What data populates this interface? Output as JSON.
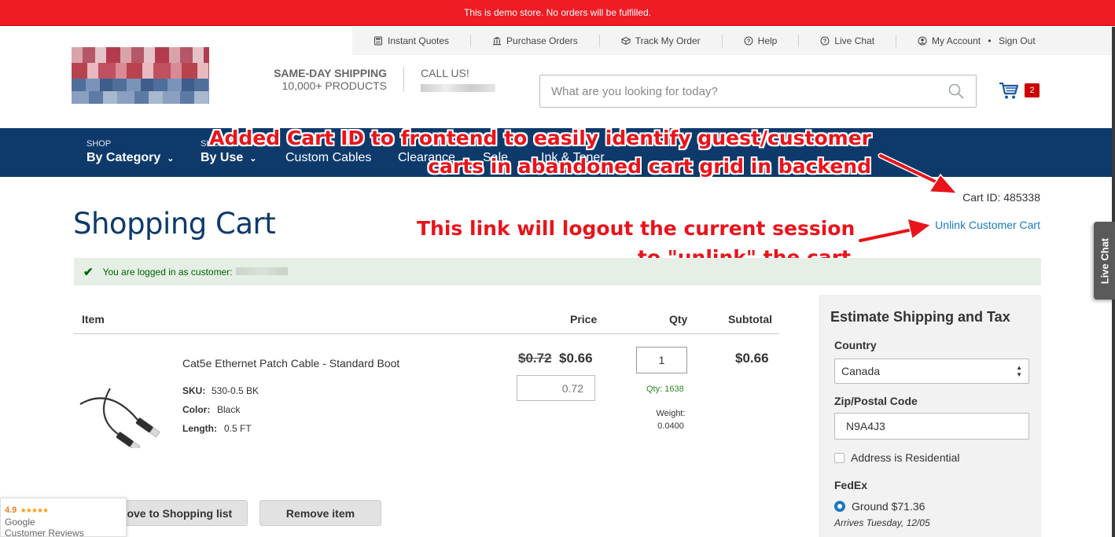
{
  "demo_notice": "This is demo store. No orders will be fulfilled.",
  "top_links": [
    {
      "label": "Instant Quotes",
      "icon": "calculator-icon"
    },
    {
      "label": "Purchase Orders",
      "icon": "bank-icon"
    },
    {
      "label": "Track My Order",
      "icon": "box-icon"
    },
    {
      "label": "Help",
      "icon": "help-icon"
    },
    {
      "label": "Live Chat",
      "icon": "chat-icon"
    },
    {
      "label": "My Account",
      "icon": "account-icon",
      "extra": "Sign Out"
    }
  ],
  "header": {
    "shipping_line1": "SAME-DAY SHIPPING",
    "shipping_line2": "10,000+ PRODUCTS",
    "call_label": "CALL US!",
    "search_placeholder": "What are you looking for today?",
    "cart_count": "2"
  },
  "nav": [
    {
      "small": "SHOP",
      "label": "By Category",
      "dropdown": true
    },
    {
      "small": "SHOP",
      "label": "By Use",
      "dropdown": true
    },
    {
      "small": "",
      "label": "Custom Cables",
      "dropdown": false
    },
    {
      "small": "",
      "label": "Clearance",
      "dropdown": false
    },
    {
      "small": "",
      "label": "Sale",
      "dropdown": false
    },
    {
      "small": "",
      "label": "Ink & Toner",
      "dropdown": false
    }
  ],
  "annotations": {
    "cart_id_note_line1": "Added Cart ID to frontend to easily identify guest/customer",
    "cart_id_note_line2": "carts in abandoned cart grid in backend",
    "unlink_note_line1": "This link will logout the current session",
    "unlink_note_line2": "to \"unlink\" the cart"
  },
  "cart_meta": {
    "cart_id": "Cart ID: 485338",
    "unlink_label": "Unlink Customer Cart"
  },
  "page_title": "Shopping Cart",
  "message": "You are logged in as customer:",
  "table": {
    "headers": {
      "item": "Item",
      "price": "Price",
      "qty": "Qty",
      "subtotal": "Subtotal"
    },
    "rows": [
      {
        "name": "Cat5e Ethernet Patch Cable - Standard Boot",
        "options": [
          {
            "label": "SKU:",
            "value": "530-0.5 BK"
          },
          {
            "label": "Color:",
            "value": "Black"
          },
          {
            "label": "Length:",
            "value": "0.5 FT"
          }
        ],
        "old_price": "$0.72",
        "price": "$0.66",
        "price_input": "0.72",
        "qty": "1",
        "stock": "Qty: 1638",
        "weight_label": "Weight:",
        "weight_value": "0.0400",
        "subtotal": "$0.66"
      }
    ]
  },
  "actions": {
    "move_to_list": "Move to Shopping list",
    "remove": "Remove item"
  },
  "reviews": {
    "rating": "4.9",
    "stars": "★★★★★",
    "brand": "Google",
    "label": "Customer Reviews"
  },
  "estimate": {
    "title": "Estimate Shipping and Tax",
    "country_label": "Country",
    "country_value": "Canada",
    "zip_label": "Zip/Postal Code",
    "zip_value": "N9A4J3",
    "residential_label": "Address is Residential",
    "carrier": "FedEx",
    "method": "Ground $71.36",
    "arrives": "Arrives Tuesday, 12/05"
  },
  "live_chat_tab": "Live Chat",
  "colors": {
    "demo_red": "#ee1c25",
    "nav_blue": "#0e3a6b",
    "link_blue": "#1979c3",
    "annotation_red": "#e8141b"
  }
}
